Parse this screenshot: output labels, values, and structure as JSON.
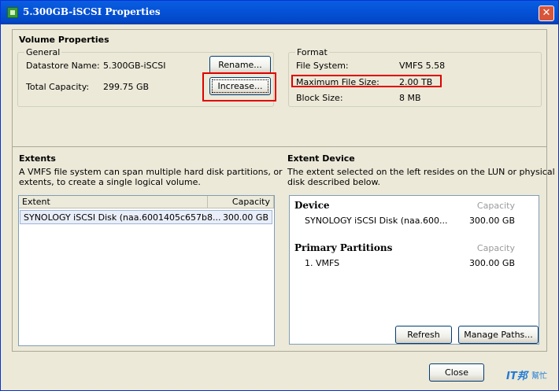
{
  "window": {
    "title": "5.300GB-iSCSI Properties",
    "close_glyph": "✕"
  },
  "volume_properties": {
    "heading": "Volume Properties",
    "general": {
      "legend": "General",
      "datastore_label": "Datastore Name:",
      "datastore_value": "5.300GB-iSCSI",
      "capacity_label": "Total Capacity:",
      "capacity_value": "299.75 GB",
      "rename_button": "Rename...",
      "increase_button": "Increase..."
    },
    "format": {
      "legend": "Format",
      "fs_label": "File System:",
      "fs_value": "VMFS 5.58",
      "max_label": "Maximum File Size:",
      "max_value": "2.00 TB",
      "block_label": "Block Size:",
      "block_value": "8 MB"
    }
  },
  "extents": {
    "heading": "Extents",
    "description_line1": "A VMFS file system can span multiple hard disk partitions, or",
    "description_line2": "extents, to create a single logical volume.",
    "columns": [
      "Extent",
      "Capacity"
    ],
    "rows": [
      {
        "extent": "SYNOLOGY iSCSI Disk (naa.6001405c657b8...",
        "capacity": "300.00 GB"
      }
    ]
  },
  "extent_device": {
    "heading": "Extent Device",
    "description_line1": "The extent selected on the left resides on the LUN or physical",
    "description_line2": "disk described below.",
    "device_heading": "Device",
    "capacity_heading": "Capacity",
    "device_name": "SYNOLOGY iSCSI Disk (naa.600...",
    "device_capacity": "300.00 GB",
    "partitions_heading": "Primary Partitions",
    "partition_capacity_heading": "Capacity",
    "partition_name": "1. VMFS",
    "partition_capacity": "300.00 GB",
    "refresh_button": "Refresh",
    "manage_paths_button": "Manage Paths..."
  },
  "footer": {
    "close_button": "Close"
  },
  "watermark": {
    "text": "IT邦",
    "subtext": "幫忙"
  },
  "colors": {
    "title_bar": "#0553d8",
    "highlight": "#e00000",
    "dialog_bg": "#ece9d8"
  }
}
